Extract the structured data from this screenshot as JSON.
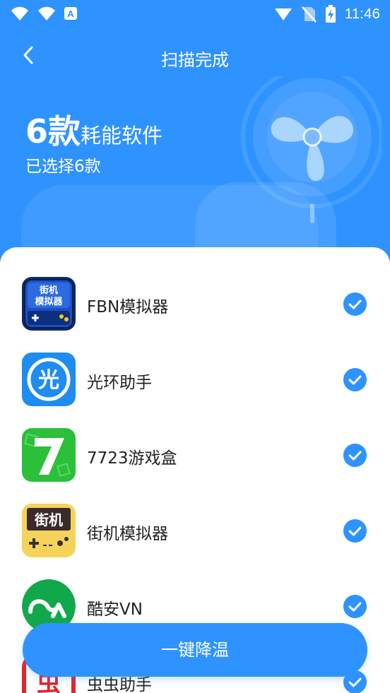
{
  "status_bar": {
    "time": "11:46",
    "left_icons": [
      "wifi-icon",
      "wifi-icon",
      "app-notification-icon"
    ],
    "right_icons": [
      "signal-icon",
      "no-sim-icon",
      "battery-charging-icon"
    ]
  },
  "header": {
    "title": "扫描完成",
    "count": "6款",
    "count_label": "耗能软件",
    "selected_text": "已选择6款"
  },
  "apps": [
    {
      "name": "FBN模拟器",
      "icon": "fbn-emulator-icon",
      "checked": true
    },
    {
      "name": "光环助手",
      "icon": "guanghuan-icon",
      "checked": true
    },
    {
      "name": "7723游戏盒",
      "icon": "7723-game-box-icon",
      "checked": true
    },
    {
      "name": "街机模拟器",
      "icon": "arcade-emulator-icon",
      "checked": true
    },
    {
      "name": "酷安VN",
      "icon": "coolapk-icon",
      "checked": true
    },
    {
      "name": "虫虫助手",
      "icon": "chongchong-icon",
      "checked": true
    }
  ],
  "action_button": {
    "label": "一键降温"
  },
  "colors": {
    "primary": "#2f93ff",
    "text": "#222222"
  }
}
